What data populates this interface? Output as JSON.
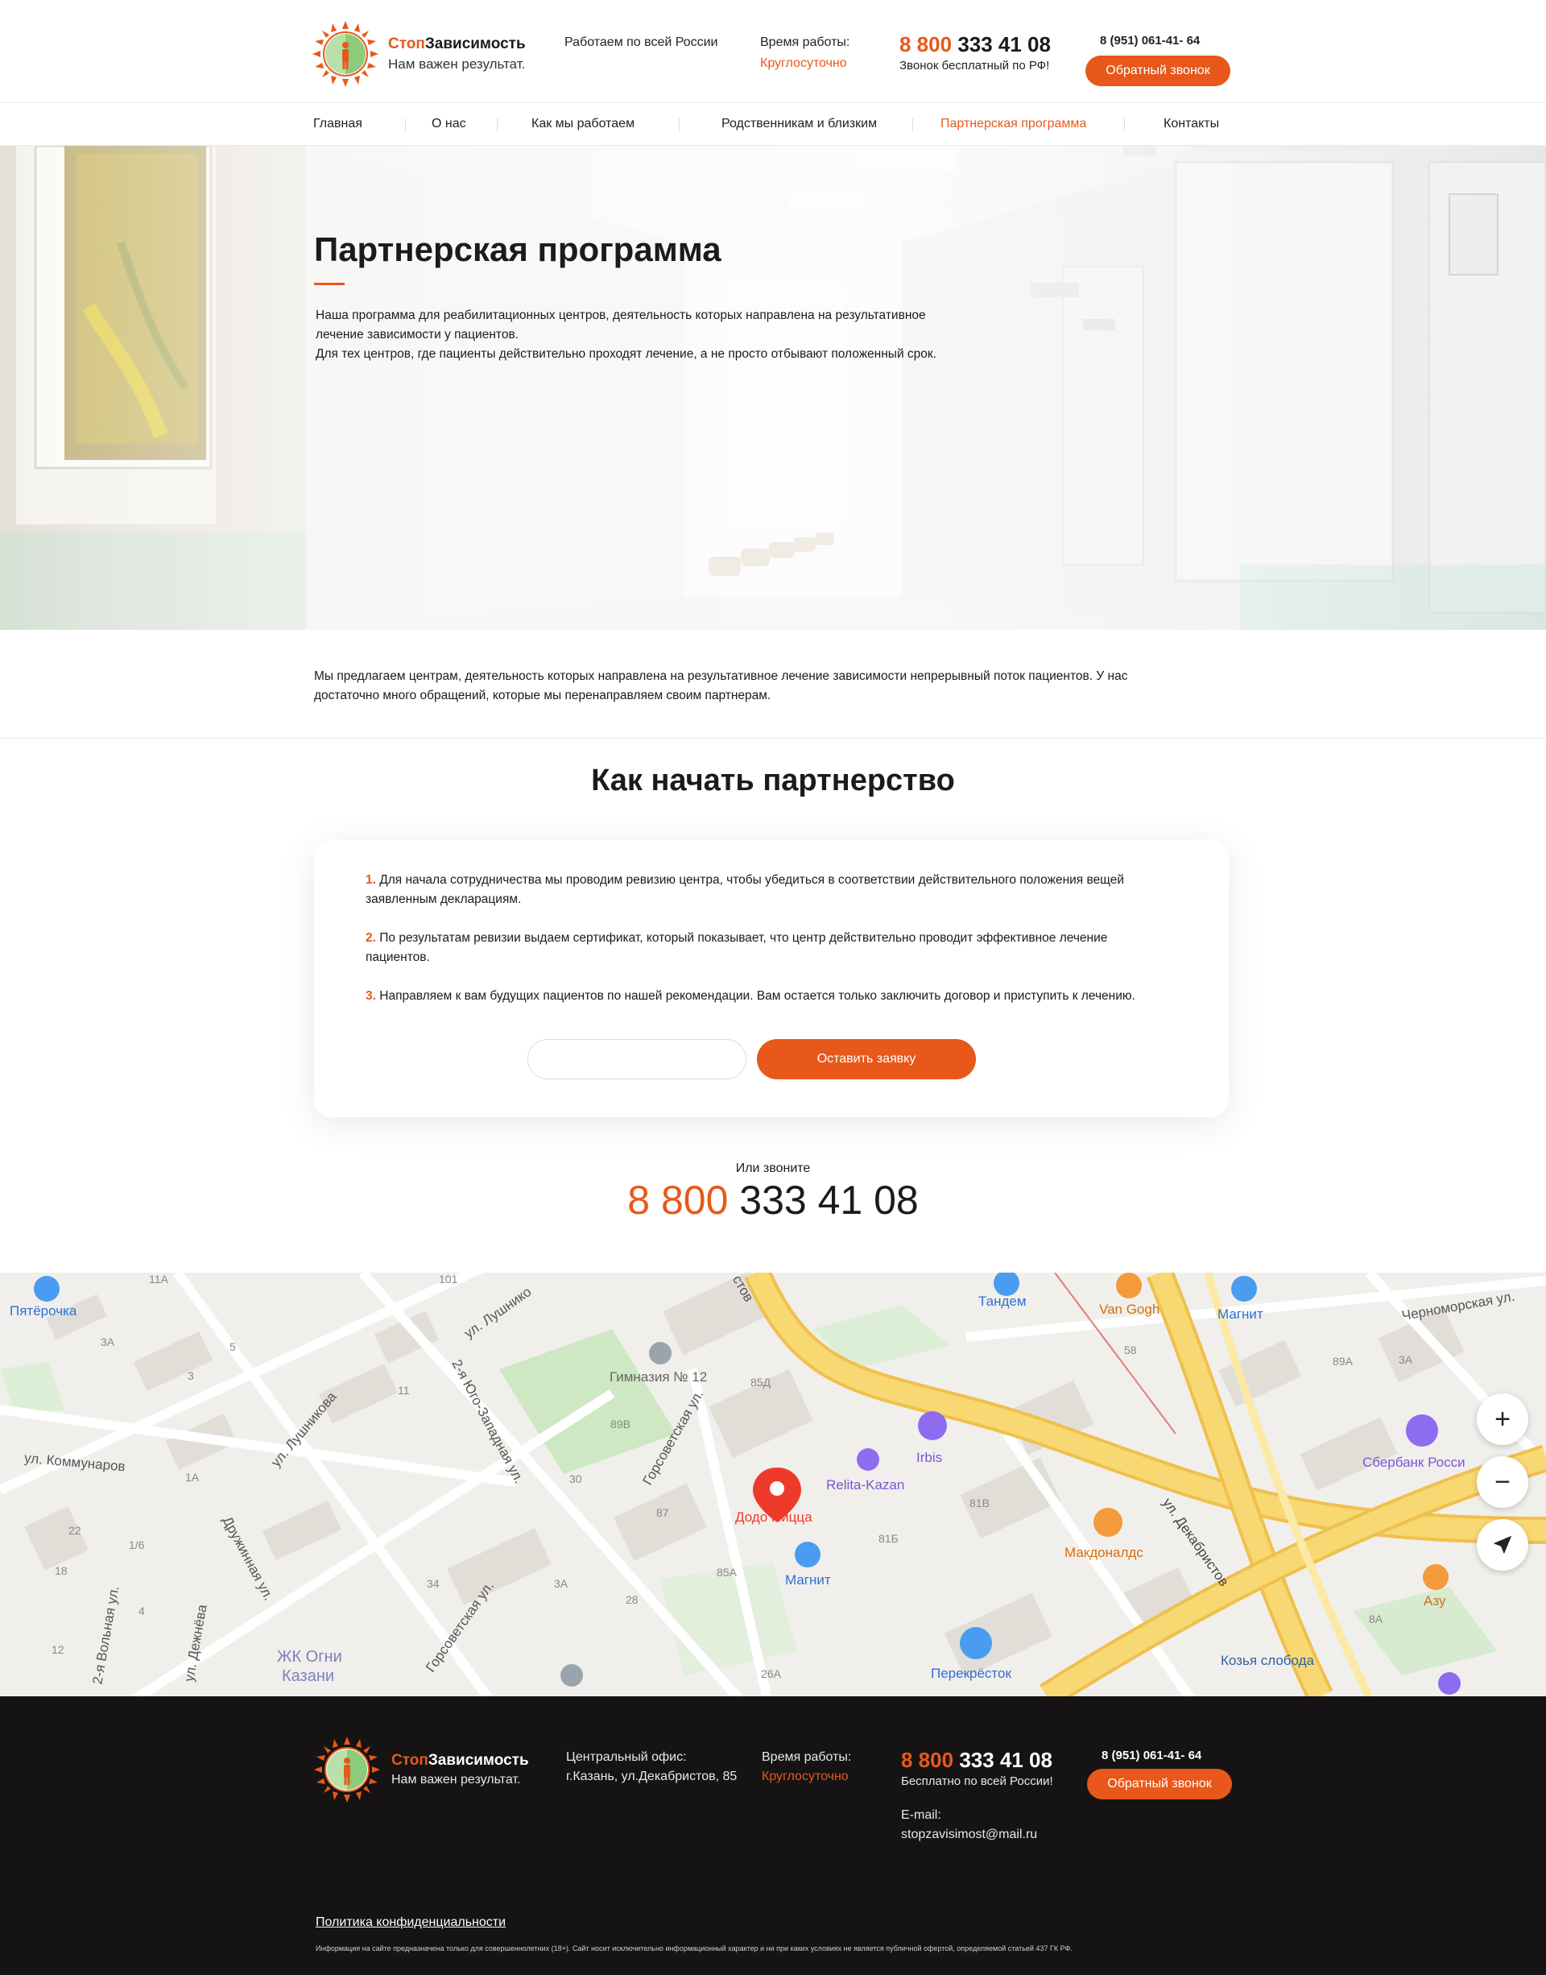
{
  "header": {
    "logo_prefix": "Стоп",
    "logo_suffix": "Зависимость",
    "slogan": "Нам важен результат.",
    "region": "Работаем по всей России",
    "hours_label": "Время работы:",
    "hours_value": "Круглосуточно",
    "phone_prefix": "8 800",
    "phone_rest": "333 41 08",
    "phone_note": "Звонок бесплатный по РФ!",
    "phone2": "8 (951) 061-41- 64",
    "callback_label": "Обратный звонок"
  },
  "nav": {
    "items": [
      {
        "label": "Главная"
      },
      {
        "label": "О нас"
      },
      {
        "label": "Как мы работаем"
      },
      {
        "label": "Родственникам и близким"
      },
      {
        "label": "Партнерская программа"
      },
      {
        "label": "Контакты"
      }
    ]
  },
  "hero": {
    "title": "Партнерская программа",
    "line1": "Наша программа для реабилитационных центров, деятельность которых направлена на результативное",
    "line2": "лечение зависимости у пациентов.",
    "line3": "Для тех центров, где пациенты действительно проходят лечение, а не просто отбывают положенный срок."
  },
  "intro": {
    "line1": "Мы предлагаем центрам, деятельность которых направлена на результативное лечение зависимости  непрерывный поток пациентов. У нас",
    "line2": "достаточно много обращений, которые мы перенаправляем своим партнерам."
  },
  "partnership": {
    "title": "Как начать партнерство",
    "steps": [
      {
        "num": "1.",
        "line1": "Для начала сотрудничества мы проводим ревизию центра, чтобы убедиться в соответствии действительного положения вещей",
        "line2": "заявленным декларациям."
      },
      {
        "num": "2.",
        "line1": "По результатам ревизии выдаем сертификат, который показывает, что центр действительно проводит эффективное лечение",
        "line2": "пациентов."
      },
      {
        "num": "3.",
        "line1": "Направляем к вам будущих пациентов по нашей рекомендации. Вам остается только заключить договор и приступить к лечению.",
        "line2": ""
      }
    ],
    "input_placeholder": "",
    "submit_label": "Оставить заявку",
    "or_call": "Или звоните",
    "phone_prefix": "8 800",
    "phone_rest": "333 41 08"
  },
  "map": {
    "labels": {
      "pyaterochka": "Пятёрочка",
      "tandem": "Тандем",
      "vangogh": "Van Gogh",
      "magnit_top": "Магнит",
      "chernomorskaya": "Черноморская ул.",
      "lushnikova_top": "ул. Лушнико",
      "yugo_zapadnaya": "2-я Юго-Западная ул.",
      "gimnaziya": "Гимназия № 12",
      "gorsovetskaya": "Горсоветская ул.",
      "irbis": "Irbis",
      "relita": "Relita-Kazan",
      "sberbank": "Сбербанк Росси",
      "kommunarov": "ул. Коммунаров",
      "lushnikova": "ул. Лушникова",
      "dodo": "Додо Пицца",
      "magnit": "Магнит",
      "mcdonalds": "Макдоналдс",
      "dekabristov": "ул. Декабристов",
      "azu": "Азу",
      "druzhinnaya": "Дружинная ул.",
      "gorsovetskaya2": "Горсоветская ул.",
      "perekrestok": "Перекрёсток",
      "kozya": "Козья слобода",
      "zhk": "ЖК Огни",
      "kazani": "Казани",
      "volnaya": "2-я Вольная ул.",
      "dezhneva": "ул. Дежнёва",
      "stov": "стов",
      "n11a": "11А",
      "n101": "101",
      "n3a": "3А",
      "n5": "5",
      "n3": "3",
      "n11": "11",
      "n89v": "89В",
      "n85d": "85Д",
      "n58": "58",
      "n89a": "89А",
      "n3a2": "3А",
      "n1a": "1А",
      "n22": "22",
      "n16": "1/6",
      "n18": "18",
      "n30": "30",
      "n87": "87",
      "n34": "34",
      "n3a3": "3А",
      "n28": "28",
      "n85a": "85А",
      "n81v": "81В",
      "n81b": "81Б",
      "n26a": "26А",
      "n8a": "8А",
      "n4": "4",
      "n12": "12"
    },
    "zoom_in": "+",
    "zoom_out": "−"
  },
  "footer": {
    "logo_prefix": "Стоп",
    "logo_suffix": "Зависимость",
    "slogan": "Нам важен результат.",
    "office_label": "Центральный офис:",
    "office_address": "г.Казань, ул.Декабристов, 85",
    "hours_label": "Время работы:",
    "hours_value": "Круглосуточно",
    "phone_prefix": "8 800",
    "phone_rest": "333 41 08",
    "phone_note": "Бесплатно по всей России!",
    "email_label": "E-mail:",
    "email": "stopzavisimost@mail.ru",
    "phone2": "8 (951) 061-41- 64",
    "callback_label": "Обратный звонок",
    "policy": "Политика конфиденциальности",
    "disclaimer": "Информация на сайте предназначена только для совершеннолетних (18+). Сайт носит исключительно информационный характер и ни при каких условиях не является публичной офертой, определяемой статьей 437 ГК РФ."
  },
  "colors": {
    "accent": "#e8581a",
    "footer_bg": "#151314",
    "logo_green": "#8ccb7a",
    "map_road": "#f6c84a"
  }
}
